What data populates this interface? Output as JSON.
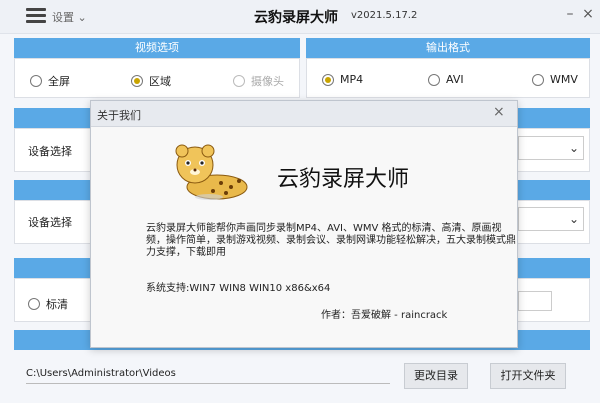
{
  "app": {
    "title": "云豹录屏大师",
    "version": "v2021.5.17.2",
    "settings_label": "设置",
    "minimize": "–",
    "close": "×"
  },
  "video_options": {
    "header": "视频选项",
    "options": [
      {
        "label": "全屏",
        "selected": false,
        "disabled": false
      },
      {
        "label": "区域",
        "selected": true,
        "disabled": false
      },
      {
        "label": "摄像头",
        "selected": false,
        "disabled": true
      }
    ]
  },
  "output_format": {
    "header": "输出格式",
    "options": [
      {
        "label": "MP4",
        "selected": true
      },
      {
        "label": "AVI",
        "selected": false
      },
      {
        "label": "WMV",
        "selected": false
      }
    ]
  },
  "device_rows": [
    {
      "label": "设备选择"
    },
    {
      "label": "设备选择"
    }
  ],
  "quality": {
    "label": "标清"
  },
  "footer": {
    "path": "C:\\Users\\Administrator\\Videos",
    "change_dir": "更改目录",
    "open_folder": "打开文件夹"
  },
  "about_dialog": {
    "title": "关于我们",
    "close": "×",
    "brand": "云豹录屏大师",
    "description": "云豹录屏大师能帮你声画同步录制MP4、AVI、WMV 格式的标清、高清、原画视频，操作简单，录制游戏视频、录制会议、录制网课功能轻松解决，五大录制模式鼎力支撑，下载即用",
    "system_support": "系统支持:WIN7 WIN8 WIN10    x86&x64",
    "author": "作者：吾爱破解 - raincrack"
  },
  "colors": {
    "accent_header": "#5aa9e6",
    "radio_selected": "#c9a400"
  }
}
